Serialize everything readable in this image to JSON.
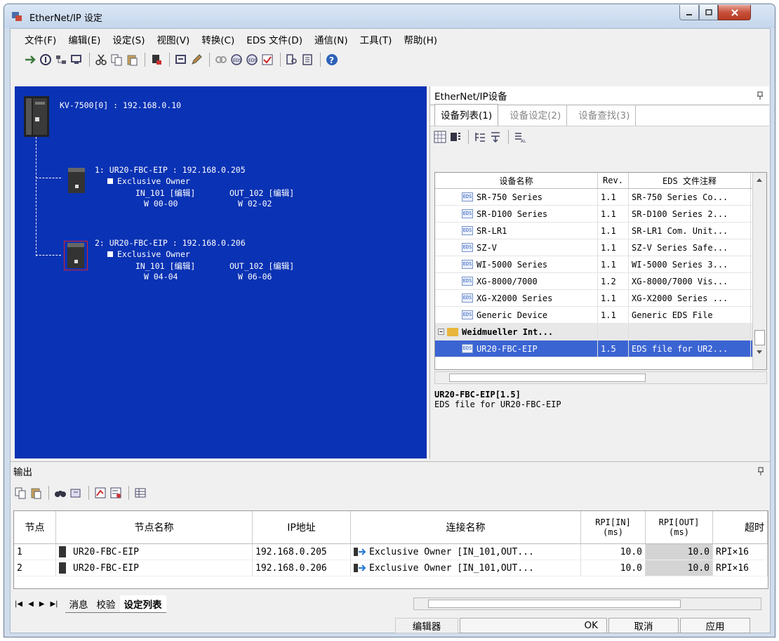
{
  "window": {
    "title": "EtherNet/IP 设定"
  },
  "menu": [
    "文件(F)",
    "编辑(E)",
    "设定(S)",
    "视图(V)",
    "转换(C)",
    "EDS 文件(D)",
    "通信(N)",
    "工具(T)",
    "帮助(H)"
  ],
  "network": {
    "plc": "KV-7500[0] : 192.168.0.10",
    "nodes": [
      {
        "title": "1: UR20-FBC-EIP : 192.168.0.205",
        "conn": "Exclusive Owner",
        "in": "IN_101 [编辑]",
        "out": "OUT_102 [编辑]",
        "in_w": "W 00-00",
        "out_w": "W 02-02"
      },
      {
        "title": "2: UR20-FBC-EIP : 192.168.0.206",
        "conn": "Exclusive Owner",
        "in": "IN_101 [编辑]",
        "out": "OUT_102 [编辑]",
        "in_w": "W 04-04",
        "out_w": "W 06-06"
      }
    ]
  },
  "devpanel": {
    "title": "EtherNet/IP设备",
    "tabs": [
      "设备列表(1)",
      "设备设定(2)",
      "设备查找(3)"
    ],
    "columns": [
      "设备名称",
      "Rev.",
      "EDS 文件注释"
    ],
    "rows": [
      {
        "name": "SR-750 Series",
        "rev": "1.1",
        "note": "SR-750 Series Co..."
      },
      {
        "name": "SR-D100 Series",
        "rev": "1.1",
        "note": "SR-D100 Series 2..."
      },
      {
        "name": "SR-LR1",
        "rev": "1.1",
        "note": "SR-LR1 Com. Unit..."
      },
      {
        "name": "SZ-V",
        "rev": "1.1",
        "note": "SZ-V Series Safe..."
      },
      {
        "name": "WI-5000 Series",
        "rev": "1.1",
        "note": "WI-5000 Series 3..."
      },
      {
        "name": "XG-8000/7000",
        "rev": "1.2",
        "note": "XG-8000/7000 Vis..."
      },
      {
        "name": "XG-X2000 Series",
        "rev": "1.1",
        "note": "XG-X2000 Series ..."
      },
      {
        "name": "Generic Device",
        "rev": "1.1",
        "note": "Generic EDS File"
      }
    ],
    "group": "Weidmueller Int...",
    "selected": {
      "name": "UR20-FBC-EIP",
      "rev": "1.5",
      "note": "EDS file for UR2..."
    },
    "desc_title": "UR20-FBC-EIP[1.5]",
    "desc_text": "EDS file for UR20-FBC-EIP"
  },
  "output": {
    "title": "输出",
    "columns": [
      "节点",
      "节点名称",
      "IP地址",
      "连接名称",
      "RPI[IN]\n(ms)",
      "RPI[OUT]\n(ms)",
      "超时"
    ],
    "rows": [
      {
        "node": "1",
        "name": "UR20-FBC-EIP",
        "ip": "192.168.0.205",
        "conn": "Exclusive Owner [IN_101,OUT...",
        "rpi_in": "10.0",
        "rpi_out": "10.0",
        "timeout": "RPI×16"
      },
      {
        "node": "2",
        "name": "UR20-FBC-EIP",
        "ip": "192.168.0.206",
        "conn": "Exclusive Owner [IN_101,OUT...",
        "rpi_in": "10.0",
        "rpi_out": "10.0",
        "timeout": "RPI×16"
      }
    ],
    "tabs": [
      "消息",
      "校验",
      "设定列表"
    ]
  },
  "status": {
    "editor": "编辑器",
    "ok": "OK",
    "cancel": "取消",
    "apply": "应用"
  }
}
